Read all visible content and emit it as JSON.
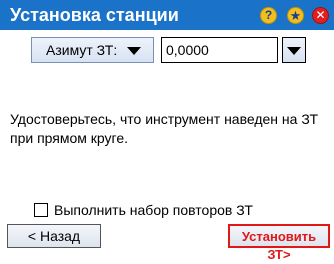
{
  "window": {
    "title": "Установка станции",
    "icons": [
      "help-icon",
      "star-icon",
      "close-icon"
    ]
  },
  "controls": {
    "mode_selected": "Азимут ЗТ:",
    "value": "0,0000"
  },
  "message": "Удостоверьтесь, что инструмент наведен на ЗТ при прямом круге.",
  "checkbox": {
    "label": "Выполнить набор повторов ЗТ",
    "checked": false
  },
  "buttons": {
    "back": "< Назад",
    "next": "Установить ЗТ>"
  },
  "colors": {
    "titlebar": "#1a73c9",
    "accent_red": "#e01818"
  }
}
